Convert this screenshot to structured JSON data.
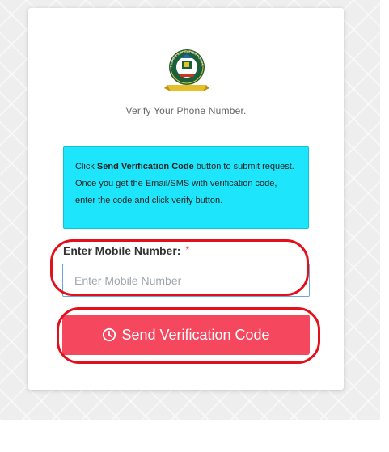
{
  "page": {
    "subtitle": "Verify Your Phone Number."
  },
  "logo": {
    "top_text": "HIGHER EDUCATION LOANS BOARD"
  },
  "info_box": {
    "prefix": "Click ",
    "bold": "Send Verification Code",
    "suffix": " button to submit request. Once you get the Email/SMS with verification code, enter the code and click verify button."
  },
  "form": {
    "mobile_label": "Enter Mobile Number:",
    "required_mark": "*",
    "mobile_placeholder": "Enter Mobile Number",
    "mobile_value": ""
  },
  "send_button": {
    "label": "Send Verification Code",
    "icon": "clock-icon"
  },
  "colors": {
    "info_bg": "#1de6fc",
    "button_bg": "#f5475e",
    "annotation_red": "#e3101b"
  }
}
